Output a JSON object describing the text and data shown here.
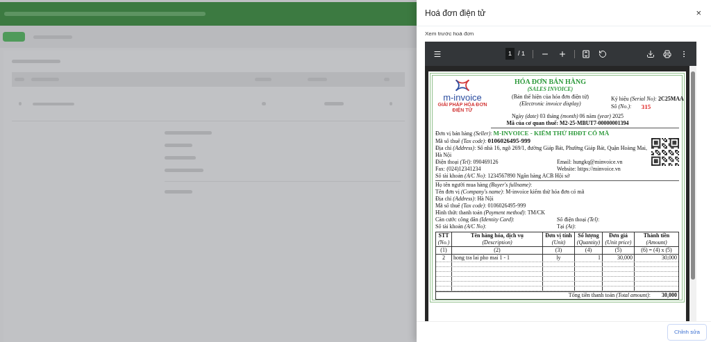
{
  "drawer": {
    "title": "Hoá đơn điện tử",
    "close": "×",
    "section_label": "Xem trước hoá đơn",
    "edit_button": "Chỉnh sửa"
  },
  "viewer": {
    "page_current": "1",
    "page_total": "/ 1"
  },
  "invoice": {
    "logo_text": "m-invoice",
    "logo_tagline": "GIẢI PHÁP HÓA ĐƠN ĐIỆN TỬ",
    "title": "HÓA ĐƠN BÁN HÀNG",
    "subtitle": "(SALES INVOICE)",
    "display_vi": "(Bản thể hiện của hóa đơn điện tử)",
    "display_en": "(Electronic invoice display)",
    "date": "Ngày *(date)* 03 tháng *(month)* 06 năm *(year)* 2025",
    "authority_code": "Mã của cơ quan thuế: M2-25-MBUT7-00000001394",
    "serial_label": "Ký hiệu *(Serial No):*",
    "serial_value": "2C25MAA",
    "number_label": "Số *(No.):*",
    "number_value": "315",
    "seller": [
      {
        "kind": "seller",
        "label": "Đơn vị bán hàng *(Seller)*:",
        "value": "M-INVOICE - KIỂM THỬ HĐĐT CÓ MÃ"
      },
      {
        "kind": "taxcode",
        "label": "Mã số thuế *(Tax code)*:",
        "value": "0106026495-999"
      },
      {
        "kind": "line",
        "label": "Địa chỉ *(Address)*:",
        "value": "Số nhà 16, ngõ 269/1, đường Giáp Bát, Phường Giáp Bát, Quận Hoàng Mai, Hà Nội"
      },
      {
        "kind": "pair",
        "label": "Điện thoại *(Tel)*:",
        "value": "090469126",
        "label2": "Email:",
        "value2": "hungkq@minvoice.vn"
      },
      {
        "kind": "pair",
        "label": "Fax:",
        "value": "(024)12341234",
        "label2": "Website:",
        "value2": "https://minvoice.vn"
      },
      {
        "kind": "line",
        "label": "Số tài khoản *(A/C No)*:",
        "value": "1234567890    Ngân hàng ACB Hội sở"
      }
    ],
    "buyer": [
      {
        "kind": "line",
        "label": "Họ tên người mua hàng *(Buyer's fullname)*:"
      },
      {
        "kind": "line",
        "label": "Tên đơn vị *(Company's name)*:",
        "value": "M-invoice kiểm thử hóa đơn có mã"
      },
      {
        "kind": "line",
        "label": "Địa chỉ *(Address)*:",
        "value": "Hà Nội"
      },
      {
        "kind": "line",
        "label": "Mã số thuế *(Tax code)*:",
        "value": "0106026495-999"
      },
      {
        "kind": "line",
        "label": "Hình thức thanh toán *(Payment method)*:",
        "value": "TM/CK"
      },
      {
        "kind": "pair",
        "label": "Căn cước công dân *(Identity Card)*:",
        "label2": "Số điện thoại *(Tel)*:"
      },
      {
        "kind": "pair",
        "label": "Số tài khoản *(A/C No)*:",
        "label2": "Tại *(At)*:"
      }
    ],
    "table_columns": [
      {
        "vi": "STT",
        "en": "(No.)",
        "num": "(1)"
      },
      {
        "vi": "Tên hàng hóa, dịch vụ",
        "en": "(Description)",
        "num": "(2)"
      },
      {
        "vi": "Đơn vị tính",
        "en": "(Unit)",
        "num": "(3)"
      },
      {
        "vi": "Số lượng",
        "en": "(Quantity)",
        "num": "(4)"
      },
      {
        "vi": "Đơn giá",
        "en": "(Unit price)",
        "num": "(5)"
      },
      {
        "vi": "Thành tiền",
        "en": "(Amount)",
        "num": "(6) = (4) x (5)"
      }
    ],
    "table_rows": [
      {
        "cells": [
          "2",
          "hong tra lai pho mai 1 - 1",
          "ly",
          "1",
          "30,000",
          "30,000"
        ]
      }
    ],
    "total_label": "Tổng tiền thanh toán *(Total amount)*:",
    "total_value": "30,000"
  }
}
